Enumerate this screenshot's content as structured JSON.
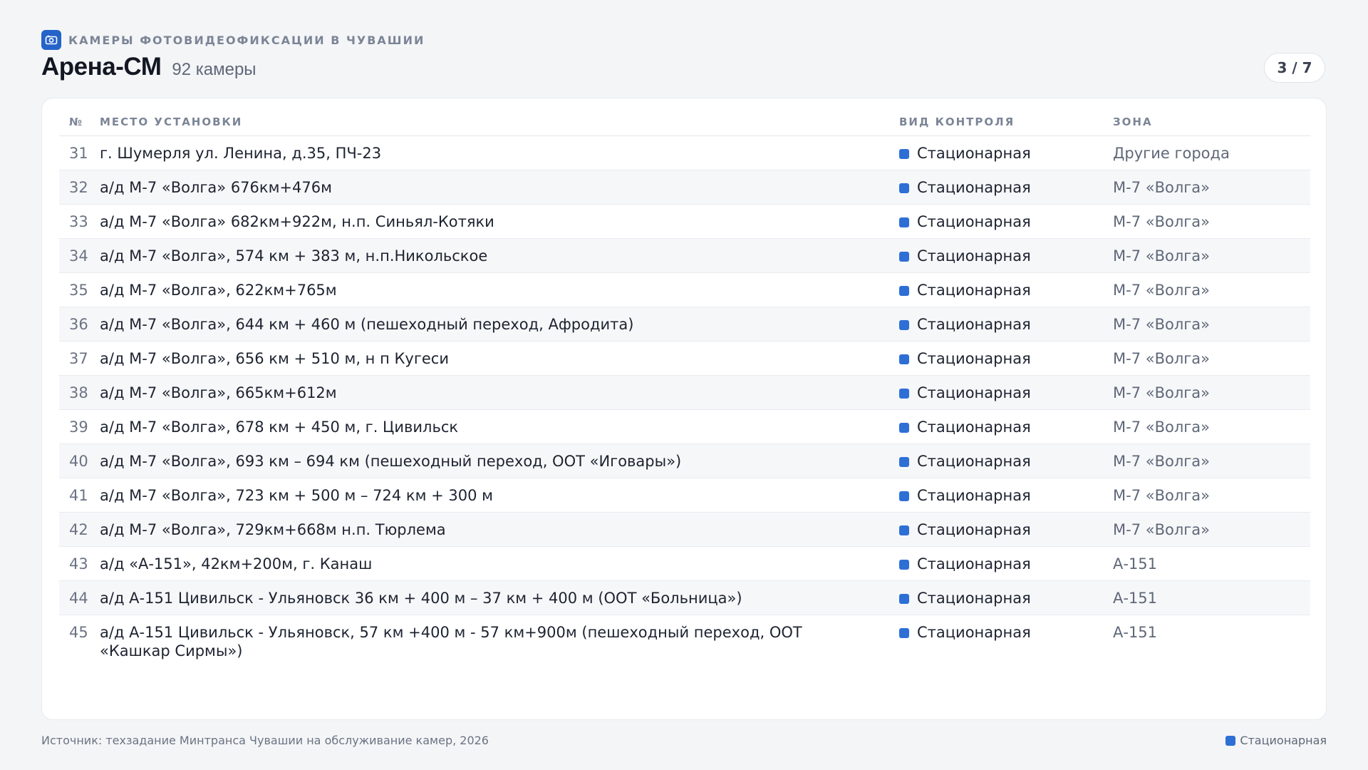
{
  "theme": {
    "accent": "#2563c9",
    "type_marker": "#2e6fd6",
    "background": "#f4f5f7",
    "card": "#ffffff",
    "stripe": "#f6f7f9"
  },
  "header": {
    "kicker_icon": "camera-icon",
    "kicker": "КАМЕРЫ ФОТОВИДЕОФИКСАЦИИ В ЧУВАШИИ",
    "title": "Арена-СМ",
    "count": "92 камеры",
    "pager": "3 / 7"
  },
  "table": {
    "columns": {
      "num": "№",
      "place": "МЕСТО УСТАНОВКИ",
      "type": "ВИД КОНТРОЛЯ",
      "zone": "ЗОНА"
    },
    "rows": [
      {
        "num": "31",
        "place": "г. Шумерля ул. Ленина, д.35, ПЧ-23",
        "type": "Стационарная",
        "zone": "Другие города"
      },
      {
        "num": "32",
        "place": "а/д М-7 «Волга» 676км+476м",
        "type": "Стационарная",
        "zone": "М-7 «Волга»"
      },
      {
        "num": "33",
        "place": "а/д М-7 «Волга» 682км+922м, н.п. Синьял-Котяки",
        "type": "Стационарная",
        "zone": "М-7 «Волга»"
      },
      {
        "num": "34",
        "place": "а/д М-7 «Волга», 574 км + 383 м, н.п.Никольское",
        "type": "Стационарная",
        "zone": "М-7 «Волга»"
      },
      {
        "num": "35",
        "place": "а/д М-7 «Волга», 622км+765м",
        "type": "Стационарная",
        "zone": "М-7 «Волга»"
      },
      {
        "num": "36",
        "place": "а/д М-7 «Волга», 644 км + 460 м (пешеходный переход, Афродита)",
        "type": "Стационарная",
        "zone": "М-7 «Волга»"
      },
      {
        "num": "37",
        "place": "а/д М-7 «Волга», 656 км + 510 м, н п Кугеси",
        "type": "Стационарная",
        "zone": "М-7 «Волга»"
      },
      {
        "num": "38",
        "place": "а/д М-7 «Волга», 665км+612м",
        "type": "Стационарная",
        "zone": "М-7 «Волга»"
      },
      {
        "num": "39",
        "place": "а/д М-7 «Волга», 678 км + 450 м, г. Цивильск",
        "type": "Стационарная",
        "zone": "М-7 «Волга»"
      },
      {
        "num": "40",
        "place": "а/д М-7 «Волга», 693 км – 694 км (пешеходный переход, ООТ «Иговары»)",
        "type": "Стационарная",
        "zone": "М-7 «Волга»"
      },
      {
        "num": "41",
        "place": "а/д М-7 «Волга», 723 км + 500 м – 724 км + 300 м",
        "type": "Стационарная",
        "zone": "М-7 «Волга»"
      },
      {
        "num": "42",
        "place": "а/д М-7 «Волга», 729км+668м н.п. Тюрлема",
        "type": "Стационарная",
        "zone": "М-7 «Волга»"
      },
      {
        "num": "43",
        "place": "а/д «А-151», 42км+200м, г. Канаш",
        "type": "Стационарная",
        "zone": "А-151"
      },
      {
        "num": "44",
        "place": "а/д А-151 Цивильск - Ульяновск 36 км + 400 м – 37 км + 400 м (ООТ «Больница»)",
        "type": "Стационарная",
        "zone": "А-151"
      },
      {
        "num": "45",
        "place": "а/д А-151 Цивильск - Ульяновск, 57 км +400 м - 57 км+900м (пешеходный переход, ООТ «Кашкар Сирмы»)",
        "type": "Стационарная",
        "zone": "А-151"
      }
    ]
  },
  "footer": {
    "source": "Источник: техзадание Минтранса Чувашии на обслуживание камер, 2026",
    "legend_label": "Стационарная"
  }
}
